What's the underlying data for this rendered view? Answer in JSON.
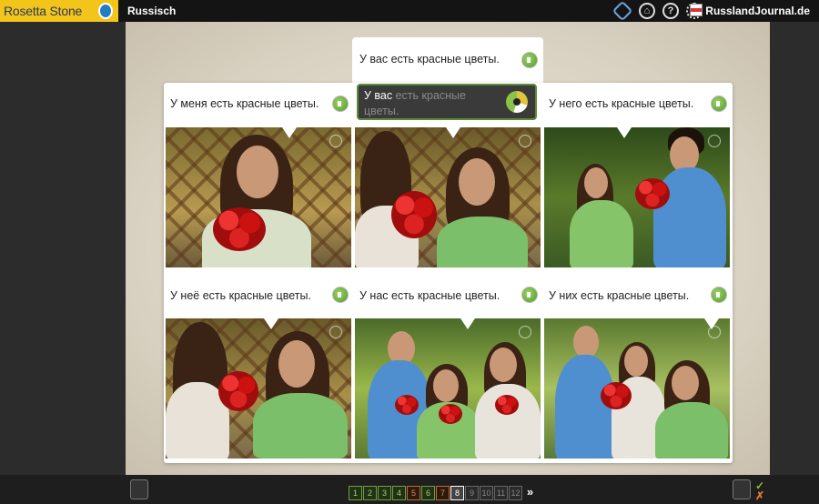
{
  "topbar": {
    "brand": "Rosetta Stone",
    "language": "Russisch",
    "user": "RusslandJournal.de",
    "icons": [
      "level-badge-icon",
      "home-icon",
      "help-icon",
      "settings-icon",
      "flag-icon"
    ]
  },
  "prompt": {
    "text": "У вас есть красные цветы."
  },
  "active_answer": {
    "text_spoken": "У вас",
    "text_pending": "есть красные",
    "text_pending2": "цветы."
  },
  "cards": [
    {
      "caption": "У меня есть красные цветы."
    },
    {
      "caption": ""
    },
    {
      "caption": "У него есть красные цветы."
    },
    {
      "caption": "У неё есть красные цветы."
    },
    {
      "caption": "У нас есть красные цветы."
    },
    {
      "caption": "У них есть красные цветы."
    }
  ],
  "pager": {
    "pages": [
      "1",
      "2",
      "3",
      "4",
      "5",
      "6",
      "7",
      "8",
      "9",
      "10",
      "11",
      "12"
    ],
    "next": "»",
    "current": "8"
  },
  "controls": {
    "check": "✓",
    "cross": "✗"
  },
  "colors": {
    "brand_yellow": "#f3c41a",
    "done_green": "#6aa23b",
    "done_orange": "#c46a2a"
  }
}
